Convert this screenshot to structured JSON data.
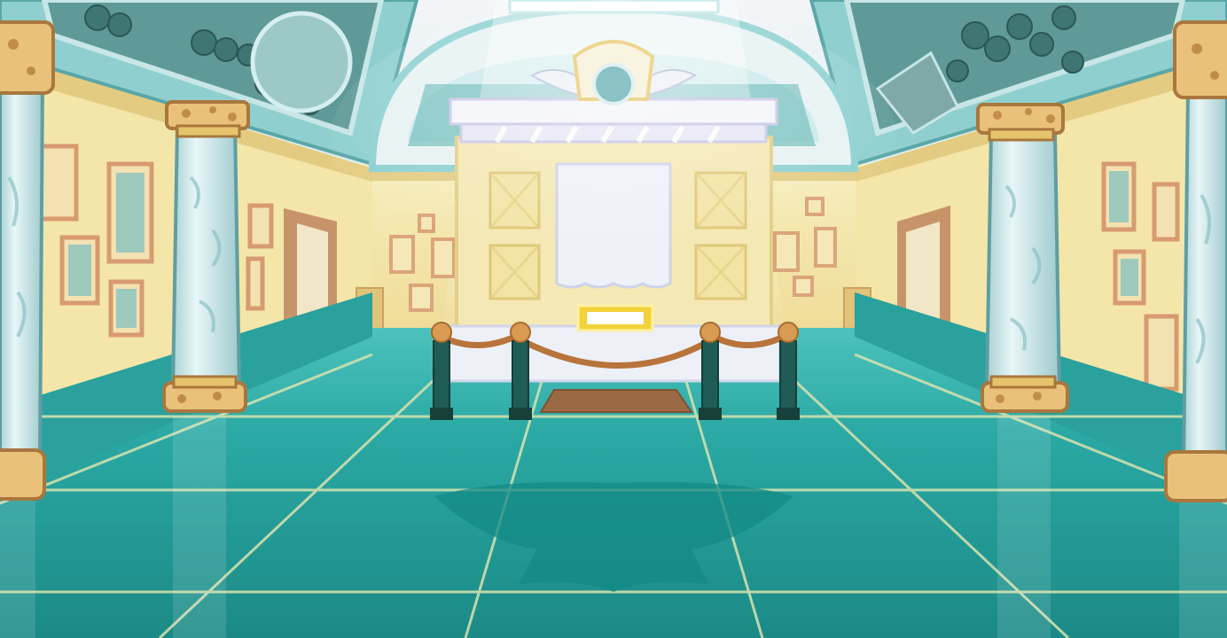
{
  "scene": {
    "type": "museum-exhibit-hall",
    "exhibit": {
      "case_state": "empty",
      "nameplate_text": ""
    },
    "stanchion_count": 4,
    "column_count": 4,
    "wall_frames_visible": true,
    "colors": {
      "floor_teal": "#27a7a2",
      "floor_dark": "#1b7d7a",
      "tile_line": "#d9e3b0",
      "wall_cream": "#f6eab2",
      "wall_shade": "#e8d38e",
      "ceiling_glass": "#bfe6e6",
      "rope_brown": "#b8743a",
      "post_green": "#1f5c55",
      "column_marble": "#cfe8ea",
      "column_cap": "#e9c17a",
      "frame_wood": "#dba57a",
      "display_white": "#eef1f6",
      "nameplate_gold": "#f3d23a"
    }
  }
}
